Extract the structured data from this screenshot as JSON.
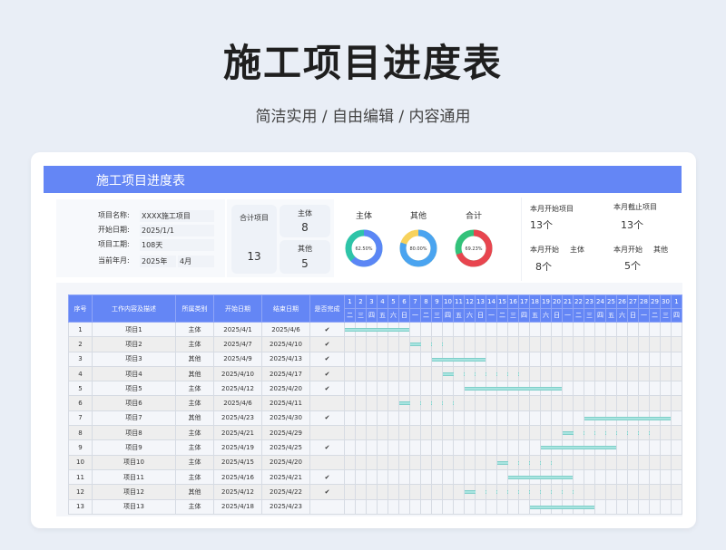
{
  "hero": {
    "title": "施工项目进度表",
    "subtitle": "简洁实用 / 自由编辑 / 内容通用"
  },
  "sheet_title": "施工项目进度表",
  "info": [
    {
      "label": "项目名称:",
      "value": "XXXX施工项目"
    },
    {
      "label": "开始日期:",
      "value": "2025/1/1"
    },
    {
      "label": "项目工期:",
      "value": "108天"
    },
    {
      "label": "当前年月:",
      "value": "2025年",
      "value2": "4月"
    }
  ],
  "totals": {
    "label": "合计项目",
    "value": "13",
    "main_label": "主体",
    "main_value": "8",
    "other_label": "其他",
    "other_value": "5"
  },
  "donuts": [
    {
      "title": "主体",
      "label": "62.50%",
      "fraction": 0.625,
      "color": "#5b86f5",
      "accent": "#2ec4a8",
      "track": "#dfe6f5"
    },
    {
      "title": "其他",
      "label": "80.00%",
      "fraction": 0.8,
      "color": "#4aa4f0",
      "accent": "#f7d25c",
      "track": "#dfe6f5"
    },
    {
      "title": "合计",
      "label": "69.23%",
      "fraction": 0.6923,
      "color": "#e8454f",
      "accent": "#33c27a",
      "track": "#dfe6f5"
    }
  ],
  "month_stats": {
    "start_label": "本月开始项目",
    "start_value": "13个",
    "end_label": "本月截止项目",
    "end_value": "13个",
    "start_main_label": "本月开始",
    "start_main_sub": "主体",
    "start_main_value": "8个",
    "start_other_label": "本月开始",
    "start_other_sub": "其他",
    "start_other_value": "5个"
  },
  "table": {
    "headers": [
      "序号",
      "工作内容及描述",
      "所属类别",
      "开始日期",
      "结束日期",
      "是否完成"
    ],
    "days": [
      "1",
      "2",
      "3",
      "4",
      "5",
      "6",
      "7",
      "8",
      "9",
      "10",
      "11",
      "12",
      "13",
      "14",
      "15",
      "16",
      "17",
      "18",
      "19",
      "20",
      "21",
      "22",
      "23",
      "24",
      "25",
      "26",
      "27",
      "28",
      "29",
      "30",
      "1"
    ],
    "weekdays": [
      "二",
      "三",
      "四",
      "五",
      "六",
      "日",
      "一",
      "二",
      "三",
      "四",
      "五",
      "六",
      "日",
      "一",
      "二",
      "三",
      "四",
      "五",
      "六",
      "日",
      "一",
      "二",
      "三",
      "四",
      "五",
      "六",
      "日",
      "一",
      "二",
      "三",
      "四"
    ],
    "rows": [
      {
        "no": "1",
        "name": "项目1",
        "cat": "主体",
        "start": "2025/4/1",
        "end": "2025/4/6",
        "done": "✔",
        "s": 1,
        "e": 6
      },
      {
        "no": "2",
        "name": "项目2",
        "cat": "主体",
        "start": "2025/4/7",
        "end": "2025/4/10",
        "done": "✔",
        "s": 7,
        "e": 10
      },
      {
        "no": "3",
        "name": "项目3",
        "cat": "其他",
        "start": "2025/4/9",
        "end": "2025/4/13",
        "done": "✔",
        "s": 9,
        "e": 13
      },
      {
        "no": "4",
        "name": "项目4",
        "cat": "其他",
        "start": "2025/4/10",
        "end": "2025/4/17",
        "done": "✔",
        "s": 10,
        "e": 17
      },
      {
        "no": "5",
        "name": "项目5",
        "cat": "主体",
        "start": "2025/4/12",
        "end": "2025/4/20",
        "done": "✔",
        "s": 12,
        "e": 20
      },
      {
        "no": "6",
        "name": "项目6",
        "cat": "主体",
        "start": "2025/4/6",
        "end": "2025/4/11",
        "done": "",
        "s": 6,
        "e": 11
      },
      {
        "no": "7",
        "name": "项目7",
        "cat": "其他",
        "start": "2025/4/23",
        "end": "2025/4/30",
        "done": "✔",
        "s": 23,
        "e": 30
      },
      {
        "no": "8",
        "name": "项目8",
        "cat": "主体",
        "start": "2025/4/21",
        "end": "2025/4/29",
        "done": "",
        "s": 21,
        "e": 29
      },
      {
        "no": "9",
        "name": "项目9",
        "cat": "主体",
        "start": "2025/4/19",
        "end": "2025/4/25",
        "done": "✔",
        "s": 19,
        "e": 25
      },
      {
        "no": "10",
        "name": "项目10",
        "cat": "主体",
        "start": "2025/4/15",
        "end": "2025/4/20",
        "done": "",
        "s": 15,
        "e": 20
      },
      {
        "no": "11",
        "name": "项目11",
        "cat": "主体",
        "start": "2025/4/16",
        "end": "2025/4/21",
        "done": "✔",
        "s": 16,
        "e": 21
      },
      {
        "no": "12",
        "name": "项目12",
        "cat": "其他",
        "start": "2025/4/12",
        "end": "2025/4/22",
        "done": "✔",
        "s": 12,
        "e": 22
      },
      {
        "no": "13",
        "name": "项目13",
        "cat": "主体",
        "start": "2025/4/18",
        "end": "2025/4/23",
        "done": "",
        "s": 18,
        "e": 23
      }
    ]
  }
}
